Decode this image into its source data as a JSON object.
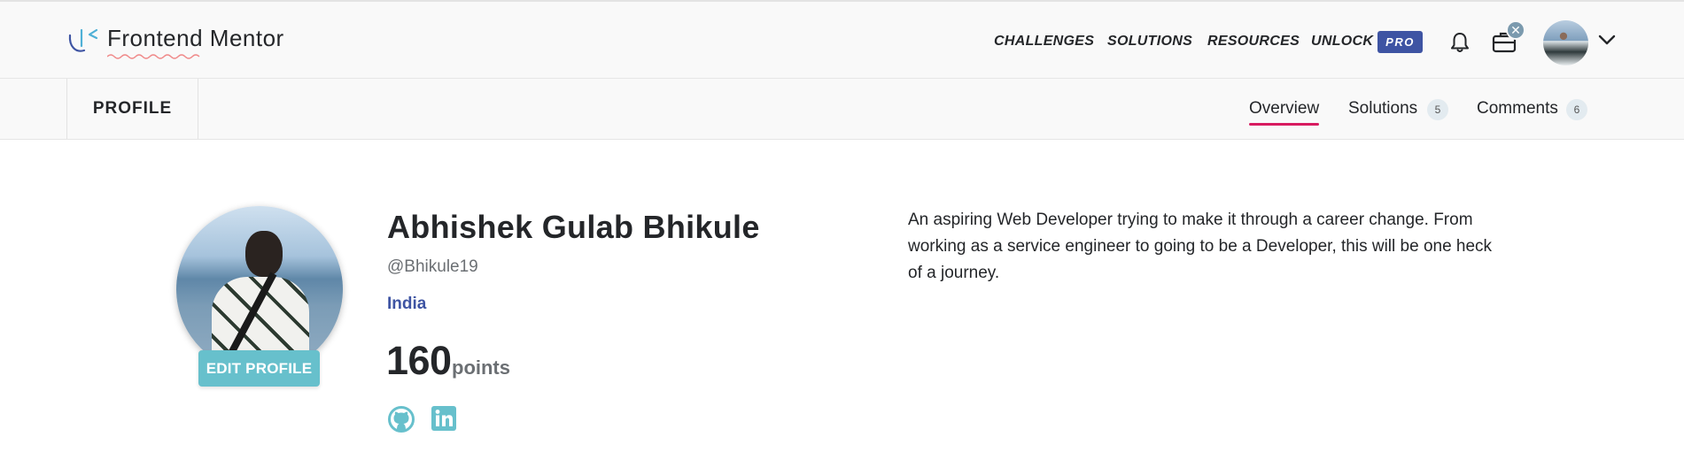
{
  "header": {
    "logo_text": "Frontend Mentor",
    "nav": [
      "CHALLENGES",
      "SOLUTIONS",
      "RESOURCES",
      "UNLOCK"
    ],
    "pro_badge": "PRO",
    "notification_close": "✕"
  },
  "subnav": {
    "section": "PROFILE",
    "tabs": [
      {
        "label": "Overview",
        "active": true
      },
      {
        "label": "Solutions",
        "count": "5"
      },
      {
        "label": "Comments",
        "count": "6"
      }
    ]
  },
  "profile": {
    "name": "Abhishek Gulab Bhikule",
    "handle": "@Bhikule19",
    "country": "India",
    "points": "160",
    "points_label": "points",
    "edit_button": "EDIT PROFILE",
    "bio": "An aspiring Web Developer trying to make it through a career change. From working as a service engineer to going to be a Developer, this will be one heck of a journey.",
    "socials": [
      "github-icon",
      "linkedin-icon"
    ]
  },
  "colors": {
    "accent_blue": "#3e54a3",
    "teal": "#67c0cc",
    "tab_underline": "#d81b60",
    "bar_bg": "#f9f9f9"
  }
}
